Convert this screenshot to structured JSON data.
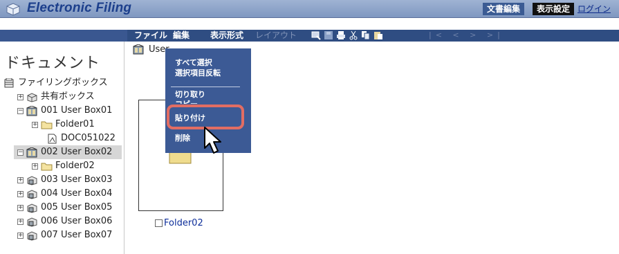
{
  "header": {
    "app_title": "Electronic Filing",
    "doc_edit_label": "文書編集",
    "display_settings_label": "表示設定",
    "login_label": "ログイン"
  },
  "menubar": {
    "file": "ファイル",
    "edit": "編集",
    "view": "表示形式",
    "layout": "レイアウト",
    "pager": "|< < > >|"
  },
  "sidebar": {
    "title": "ドキュメント",
    "items": [
      {
        "label": "ファイリングボックス"
      },
      {
        "label": "共有ボックス"
      },
      {
        "label": "001 User Box01"
      },
      {
        "label": "Folder01"
      },
      {
        "label": "DOC051022"
      },
      {
        "label": "002 User Box02"
      },
      {
        "label": "Folder02"
      },
      {
        "label": "003 User Box03"
      },
      {
        "label": "004 User Box04"
      },
      {
        "label": "005 User Box05"
      },
      {
        "label": "006 User Box06"
      },
      {
        "label": "007 User Box07"
      }
    ]
  },
  "main": {
    "breadcrumb": "User",
    "folder_label": "Folder02"
  },
  "context_menu": {
    "select_all": "すべて選択",
    "invert_selection": "選択項目反転",
    "cut": "切り取り",
    "copy": "コピー",
    "paste": "貼り付け",
    "delete": "削除"
  },
  "colors": {
    "header_bar": "#8ea4c9",
    "menubar": "#2f4d82",
    "context_menu": "#3c5a95",
    "highlight": "#e26d63",
    "link": "#0d2e9a"
  }
}
